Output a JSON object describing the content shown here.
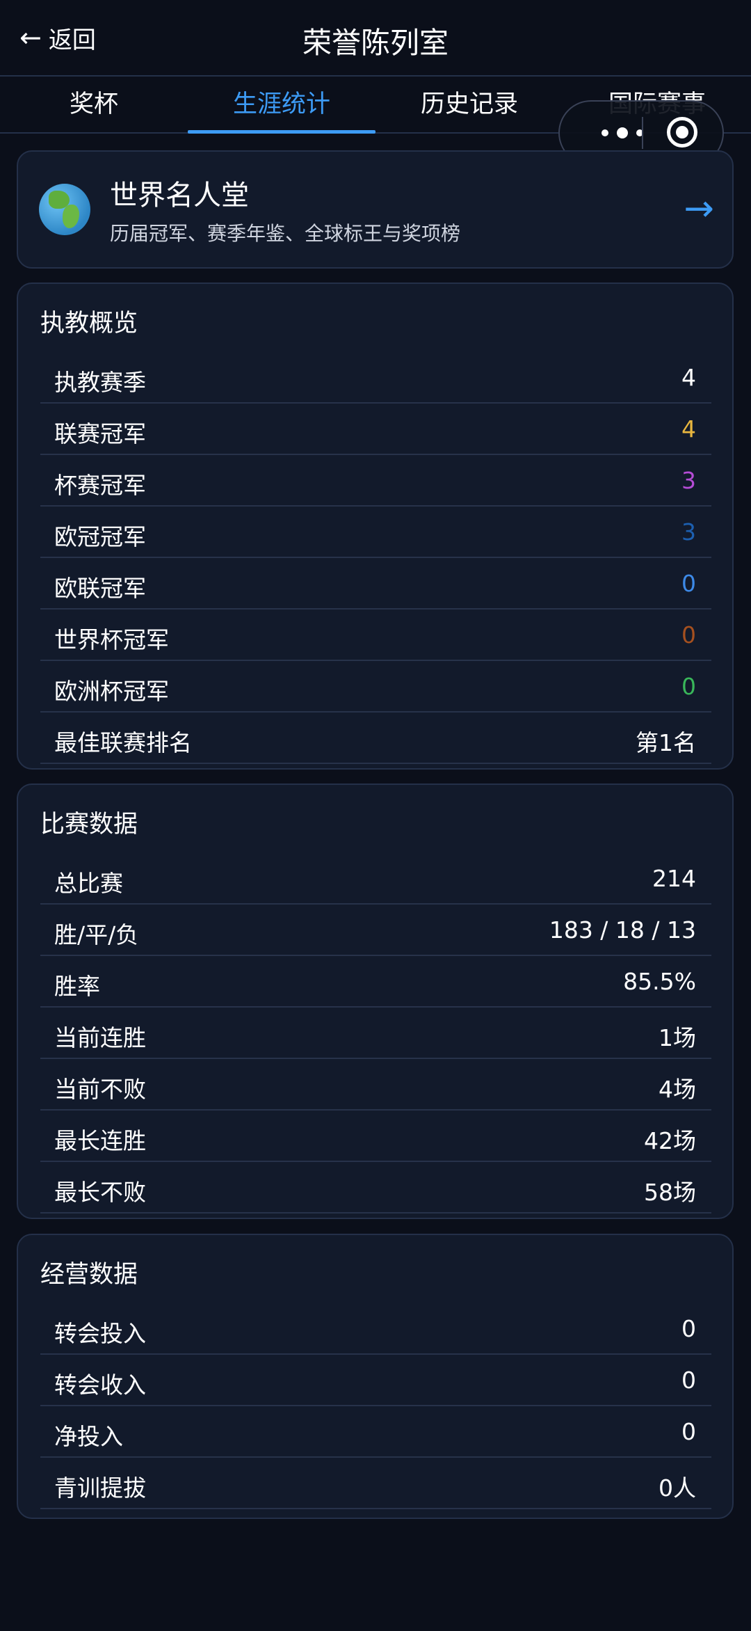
{
  "header": {
    "back_label": "返回",
    "title": "荣誉陈列室"
  },
  "tabs": [
    {
      "label": "奖杯"
    },
    {
      "label": "生涯统计"
    },
    {
      "label": "历史记录"
    },
    {
      "label": "国际赛事"
    }
  ],
  "hall_of_fame": {
    "title": "世界名人堂",
    "subtitle": "历届冠军、赛季年鉴、全球标王与奖项榜"
  },
  "overview": {
    "title": "执教概览",
    "rows": [
      {
        "label": "执教赛季",
        "value": "4",
        "color": "#ffffff"
      },
      {
        "label": "联赛冠军",
        "value": "4",
        "color": "#e8b63f"
      },
      {
        "label": "杯赛冠军",
        "value": "3",
        "color": "#b54cd6"
      },
      {
        "label": "欧冠冠军",
        "value": "3",
        "color": "#1c5fb0"
      },
      {
        "label": "欧联冠军",
        "value": "0",
        "color": "#3d8ae8"
      },
      {
        "label": "世界杯冠军",
        "value": "0",
        "color": "#a5501f"
      },
      {
        "label": "欧洲杯冠军",
        "value": "0",
        "color": "#39b75a"
      },
      {
        "label": "最佳联赛排名",
        "value": "第1名",
        "color": "#ffffff"
      }
    ]
  },
  "match_data": {
    "title": "比赛数据",
    "rows": [
      {
        "label": "总比赛",
        "value": "214"
      },
      {
        "label": "胜/平/负",
        "value": "183 / 18 / 13"
      },
      {
        "label": "胜率",
        "value": "85.5%"
      },
      {
        "label": "当前连胜",
        "value": "1场"
      },
      {
        "label": "当前不败",
        "value": "4场"
      },
      {
        "label": "最长连胜",
        "value": "42场"
      },
      {
        "label": "最长不败",
        "value": "58场"
      }
    ]
  },
  "business_data": {
    "title": "经营数据",
    "rows": [
      {
        "label": "转会投入",
        "value": "0"
      },
      {
        "label": "转会收入",
        "value": "0"
      },
      {
        "label": "净投入",
        "value": "0"
      },
      {
        "label": "青训提拔",
        "value": "0人"
      }
    ]
  }
}
